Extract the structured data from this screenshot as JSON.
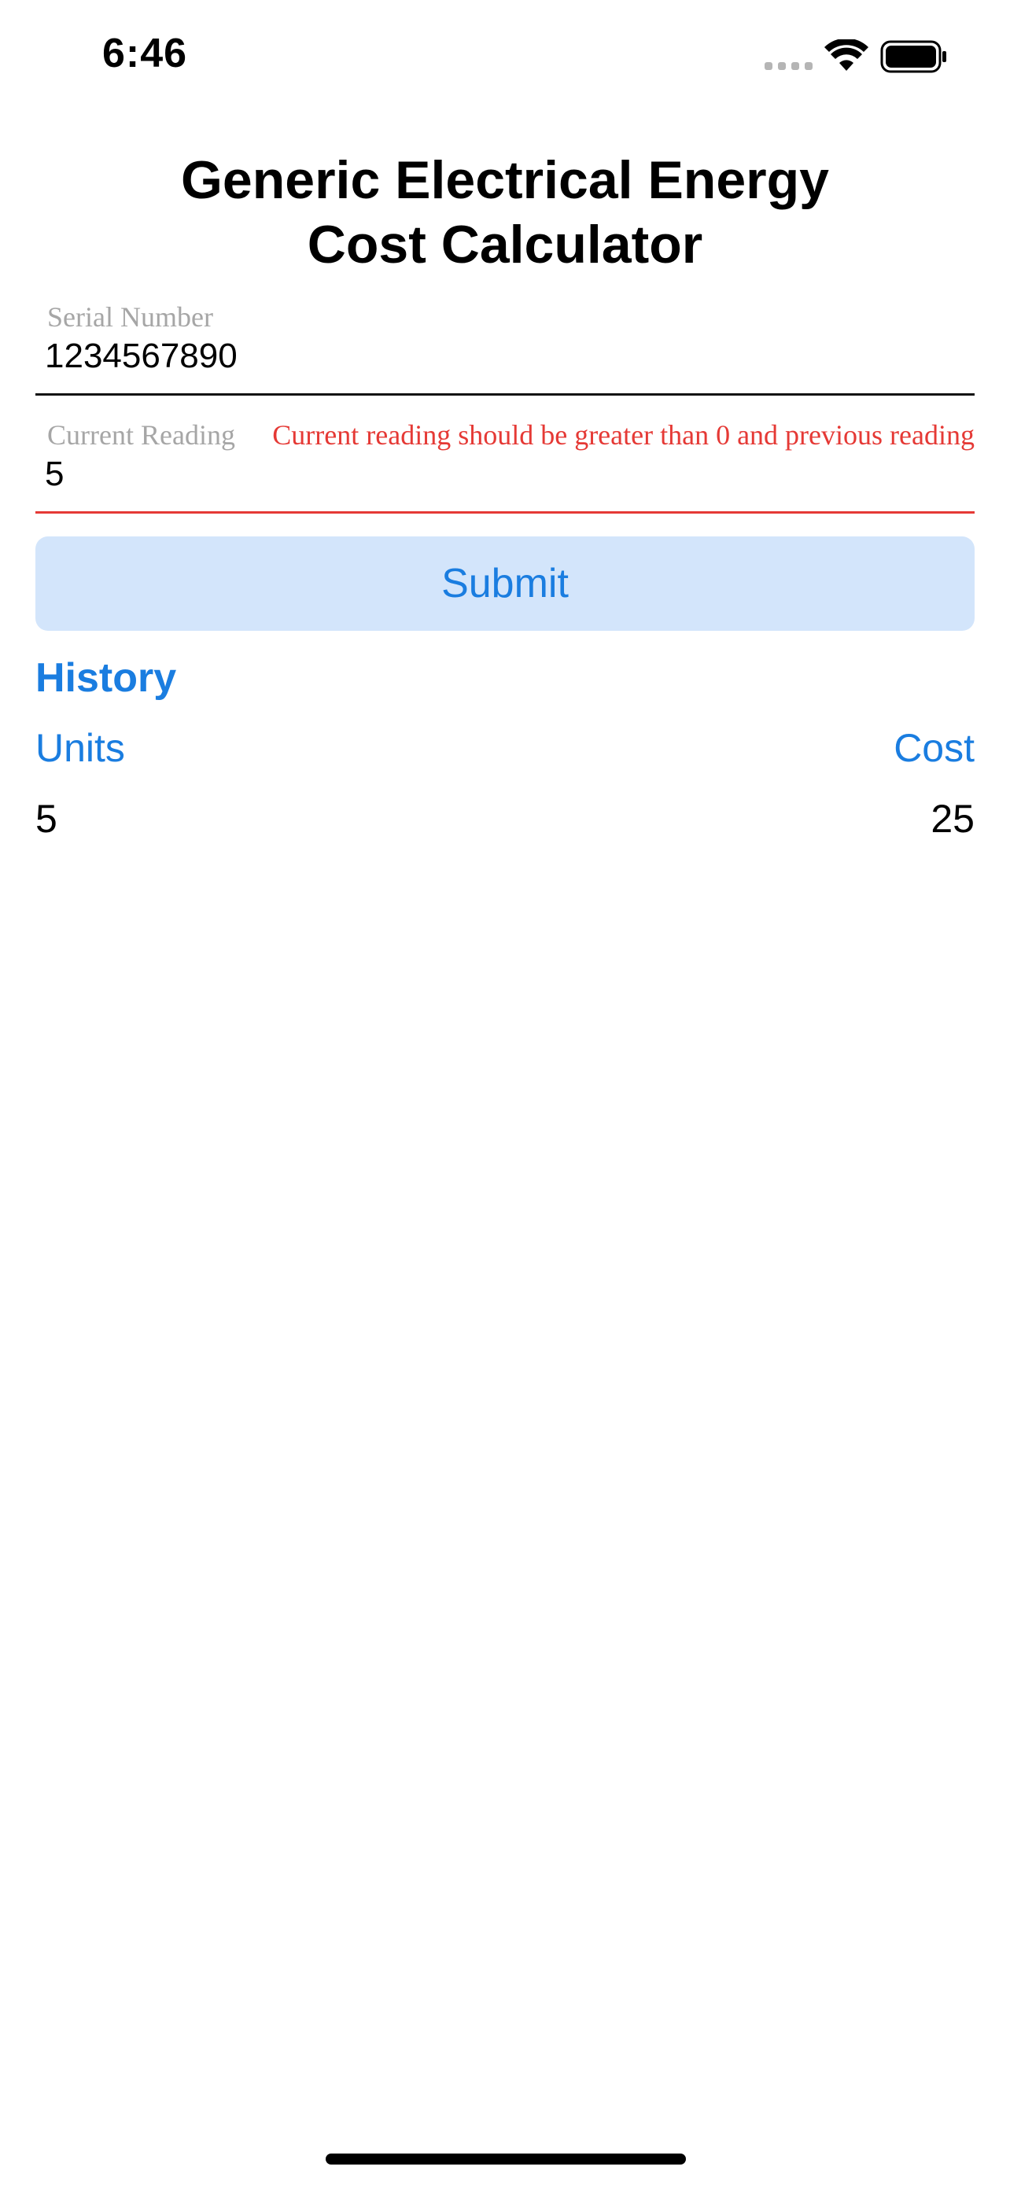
{
  "status_bar": {
    "time": "6:46",
    "icons": [
      "signal-dots-icon",
      "wifi-icon",
      "battery-icon"
    ]
  },
  "title": {
    "line1": "Generic Electrical Energy",
    "line2": "Cost Calculator"
  },
  "form": {
    "serial": {
      "label": "Serial Number",
      "value": "1234567890"
    },
    "reading": {
      "label": "Current Reading",
      "value": "5",
      "error": "Current reading should be greater than 0 and previous reading"
    },
    "submit_label": "Submit"
  },
  "history": {
    "title": "History",
    "columns": [
      "Units",
      "Cost"
    ],
    "rows": [
      {
        "units": "5",
        "cost": "25"
      }
    ]
  },
  "colors": {
    "accent": "#1a7de0",
    "button_bg": "#d3e5fb",
    "error": "#e53935",
    "label_gray": "#a6a6a6"
  }
}
